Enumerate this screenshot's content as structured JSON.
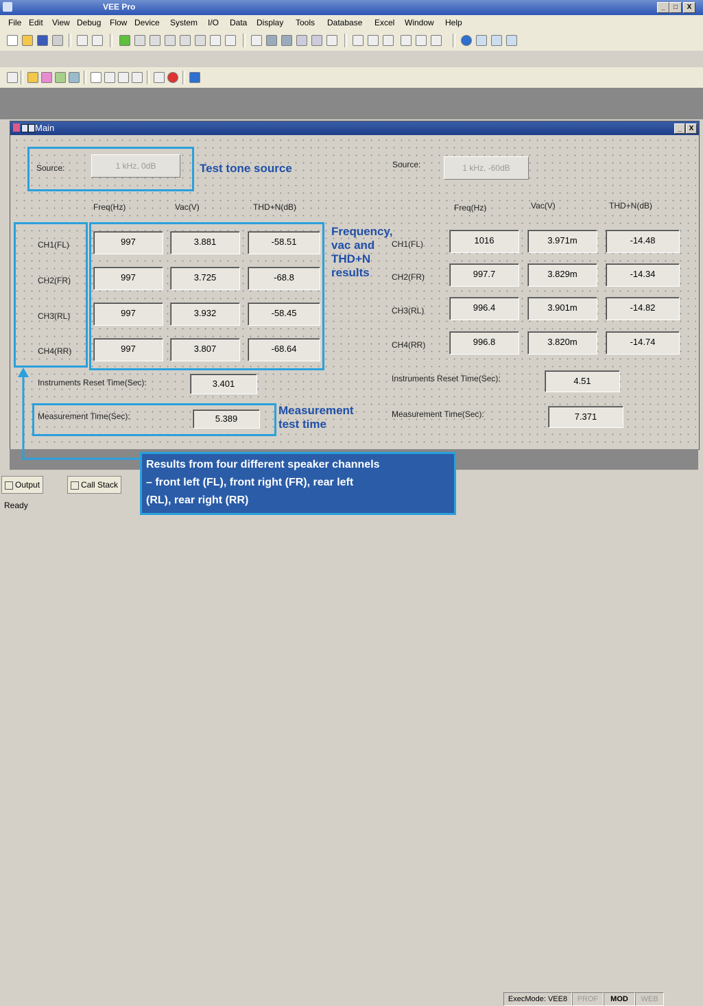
{
  "window": {
    "title": "VEE Pro",
    "controls": [
      "_",
      "□",
      "X"
    ]
  },
  "menu": [
    "File",
    "Edit",
    "View",
    "Debug",
    "Flow",
    "Device",
    "System",
    "I/O",
    "Data",
    "Display",
    "Tools",
    "Database",
    "Excel",
    "Window",
    "Help"
  ],
  "main_window": {
    "title": "Main"
  },
  "left_panel": {
    "source_label": "Source:",
    "source_value": "1 kHz, 0dB",
    "headers": [
      "Freq(Hz)",
      "Vac(V)",
      "THD+N(dB)"
    ],
    "rows": [
      {
        "channel": "CH1(FL)",
        "freq": "997",
        "vac": "3.881",
        "thd": "-58.51"
      },
      {
        "channel": "CH2(FR)",
        "freq": "997",
        "vac": "3.725",
        "thd": "-68.8"
      },
      {
        "channel": "CH3(RL)",
        "freq": "997",
        "vac": "3.932",
        "thd": "-58.45"
      },
      {
        "channel": "CH4(RR)",
        "freq": "997",
        "vac": "3.807",
        "thd": "-68.64"
      }
    ],
    "reset_label": "Instruments Reset Time(Sec):",
    "reset_value": "3.401",
    "meas_label": "Measurement Time(Sec):",
    "meas_value": "5.389"
  },
  "right_panel": {
    "source_label": "Source:",
    "source_value": "1 kHz, -60dB",
    "headers": [
      "Freq(Hz)",
      "Vac(V)",
      "THD+N(dB)"
    ],
    "rows": [
      {
        "channel": "CH1(FL)",
        "freq": "1016",
        "vac": "3.971m",
        "thd": "-14.48"
      },
      {
        "channel": "CH2(FR)",
        "freq": "997.7",
        "vac": "3.829m",
        "thd": "-14.34"
      },
      {
        "channel": "CH3(RL)",
        "freq": "996.4",
        "vac": "3.901m",
        "thd": "-14.82"
      },
      {
        "channel": "CH4(RR)",
        "freq": "996.8",
        "vac": "3.820m",
        "thd": "-14.74"
      }
    ],
    "reset_label": "Instruments Reset Time(Sec):",
    "reset_value": "4.51",
    "meas_label": "Measurement Time(Sec):",
    "meas_value": "7.371"
  },
  "annotations": {
    "source": "Test tone source",
    "results_lines": [
      "Frequency,",
      "vac and",
      "THD+N",
      "results"
    ],
    "meas_lines": [
      "Measurement",
      "test time"
    ],
    "channels_lines": [
      "Results from four different speaker channels",
      "– front left (FL), front right (FR), rear left",
      "(RL), rear right (RR)"
    ]
  },
  "tabs": [
    "Output",
    "Call Stack"
  ],
  "status": {
    "text": "Ready",
    "execmode": "ExecMode: VEE8",
    "prof": "PROF",
    "mod": "MOD",
    "web": "WEB"
  },
  "colors": {
    "highlight": "#2aa0dc",
    "annotation": "#1f4fa8"
  }
}
